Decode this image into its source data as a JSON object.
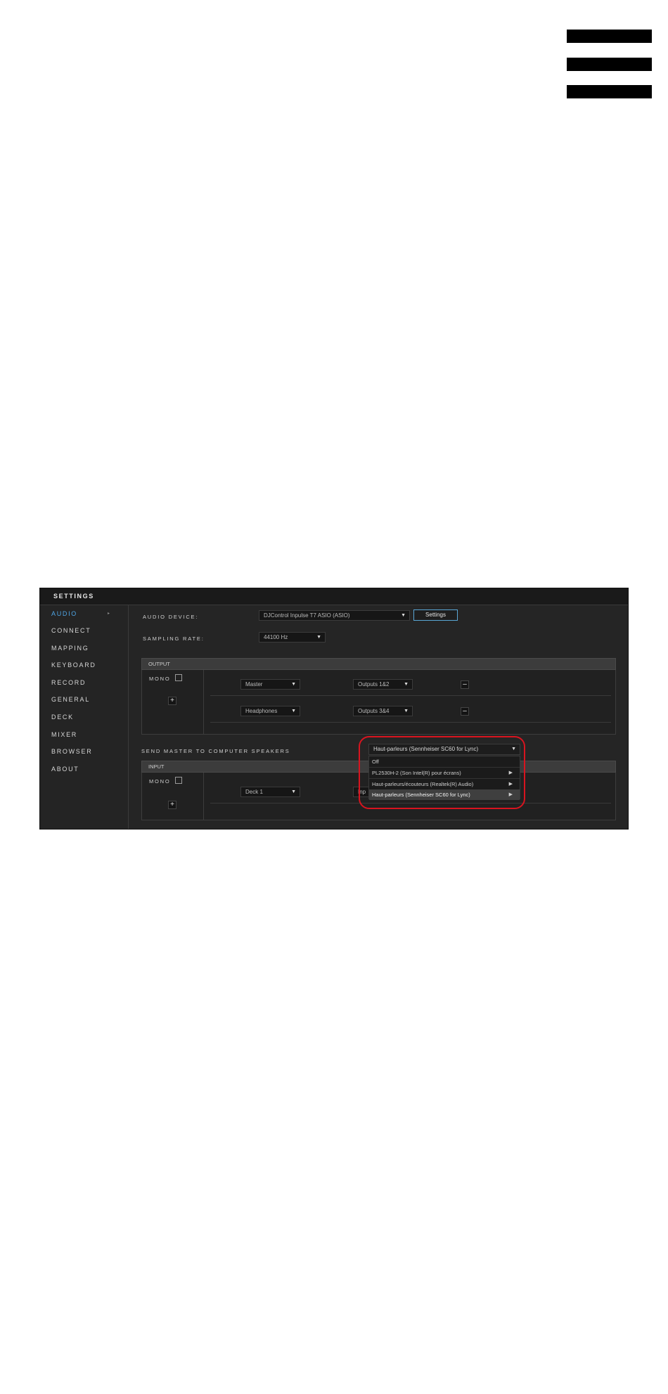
{
  "window": {
    "title": "SETTINGS"
  },
  "sidebar": {
    "items": [
      {
        "label": "AUDIO",
        "active": true
      },
      {
        "label": "CONNECT"
      },
      {
        "label": "MAPPING"
      },
      {
        "label": "KEYBOARD"
      },
      {
        "label": "RECORD"
      },
      {
        "label": "GENERAL"
      },
      {
        "label": "DECK"
      },
      {
        "label": "MIXER"
      },
      {
        "label": "BROWSER"
      },
      {
        "label": "ABOUT"
      }
    ]
  },
  "audio": {
    "device_label": "AUDIO DEVICE:",
    "device_value": "DJControl Inpulse T7 ASIO (ASIO)",
    "settings_button": "Settings",
    "sampling_label": "SAMPLING RATE:",
    "sampling_value": "44100 Hz"
  },
  "output": {
    "header": "OUTPUT",
    "mono_label": "MONO",
    "add_label": "+",
    "rows": [
      {
        "source": "Master",
        "target": "Outputs 1&2",
        "remove_label": "–"
      },
      {
        "source": "Headphones",
        "target": "Outputs 3&4",
        "remove_label": "–"
      }
    ]
  },
  "send_master": {
    "label": "SEND MASTER TO COMPUTER SPEAKERS",
    "selected": "Haut-parleurs (Sennheiser SC60 for Lync)",
    "options": [
      {
        "label": "Off"
      },
      {
        "label": "PL2530H-2 (Son Intel(R) pour écrans)"
      },
      {
        "label": "Haut-parleurs/écouteurs (Realtek(R) Audio)"
      },
      {
        "label": "Haut-parleurs (Sennheiser SC60 for Lync)"
      }
    ]
  },
  "input": {
    "header": "INPUT",
    "mono_label": "MONO",
    "add_label": "+",
    "rows": [
      {
        "source": "Deck 1",
        "target_partial": "Inp"
      }
    ]
  },
  "icons": {
    "dropdown": "caret-down-icon",
    "submenu": "play-arrow-icon"
  },
  "colors": {
    "accent": "#4fa6e6",
    "highlight": "#d8141f"
  }
}
